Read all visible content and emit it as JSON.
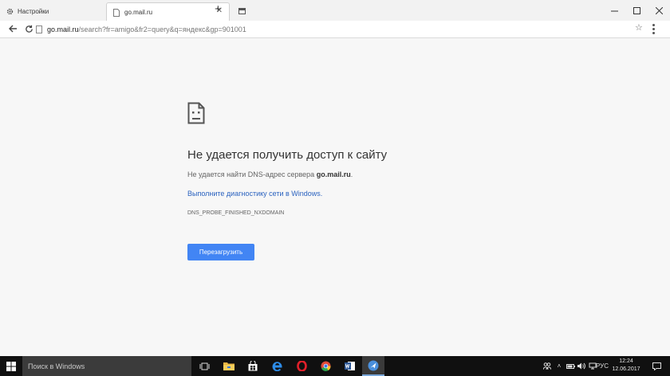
{
  "tabs": [
    {
      "title": "Настройки",
      "icon": "gear-icon",
      "active": false
    },
    {
      "title": "go.mail.ru",
      "icon": "page-icon",
      "active": true
    }
  ],
  "address_bar": {
    "host": "go.mail.ru",
    "path": "/search?fr=amigo&fr2=query&q=яндекс&gp=901001"
  },
  "error": {
    "title": "Не удается получить доступ к сайту",
    "description_prefix": "Не удается найти DNS-адрес сервера ",
    "description_host": "go.mail.ru",
    "description_suffix": ".",
    "diagnostics_link": "Выполните диагностику сети в Windows.",
    "error_code": "DNS_PROBE_FINISHED_NXDOMAIN",
    "reload_label": "Перезагрузить"
  },
  "taskbar": {
    "search_placeholder": "Поиск в Windows",
    "pinned_apps": [
      "task-view-icon",
      "file-explorer-icon",
      "store-icon",
      "edge-icon",
      "opera-icon",
      "chrome-icon",
      "word-icon",
      "amigo-icon"
    ],
    "language": "РУС",
    "time": "12:24",
    "date": "12.06.2017"
  },
  "colors": {
    "accent_button": "#4285f4",
    "link": "#2a62bf",
    "taskbar": "#101010"
  }
}
